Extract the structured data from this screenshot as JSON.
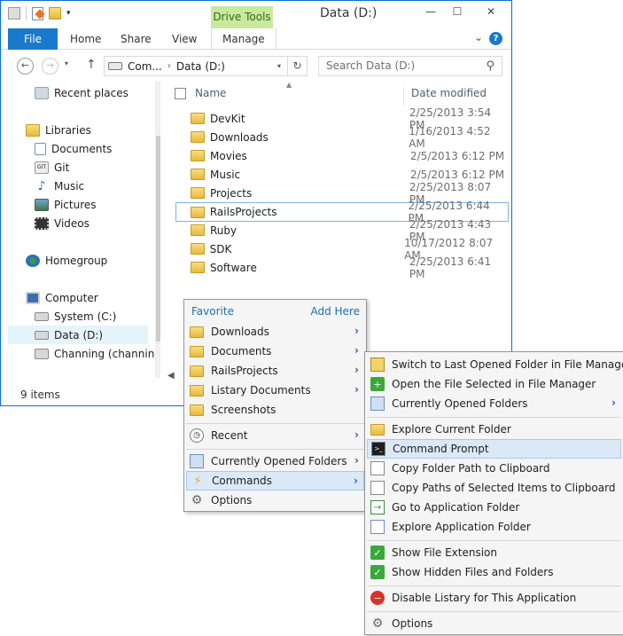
{
  "window": {
    "title": "Data (D:)",
    "context_tab_group": "Drive Tools",
    "tabs": {
      "file": "File",
      "home": "Home",
      "share": "Share",
      "view": "View",
      "manage": "Manage"
    },
    "address": {
      "part1": "Com...",
      "part2": "Data (D:)"
    },
    "search_placeholder": "Search Data (D:)",
    "status": "9 items"
  },
  "nav": {
    "items": [
      {
        "label": "Recent places",
        "icon": "recent-places-icon"
      },
      {
        "label": "Libraries",
        "icon": "libraries-icon"
      },
      {
        "label": "Documents",
        "icon": "documents-icon"
      },
      {
        "label": "Git",
        "icon": "git-icon"
      },
      {
        "label": "Music",
        "icon": "music-icon"
      },
      {
        "label": "Pictures",
        "icon": "pictures-icon"
      },
      {
        "label": "Videos",
        "icon": "videos-icon"
      },
      {
        "label": "Homegroup",
        "icon": "homegroup-icon"
      },
      {
        "label": "Computer",
        "icon": "computer-icon"
      },
      {
        "label": "System (C:)",
        "icon": "drive-icon"
      },
      {
        "label": "Data (D:)",
        "icon": "drive-icon"
      },
      {
        "label": "Channing (channing",
        "icon": "network-drive-icon"
      }
    ]
  },
  "list": {
    "headers": {
      "name": "Name",
      "date": "Date modified"
    },
    "rows": [
      {
        "name": "DevKit",
        "date": "2/25/2013 3:54 PM"
      },
      {
        "name": "Downloads",
        "date": "1/16/2013 4:52 AM"
      },
      {
        "name": "Movies",
        "date": "2/5/2013 6:12 PM"
      },
      {
        "name": "Music",
        "date": "2/5/2013 6:12 PM"
      },
      {
        "name": "Projects",
        "date": "2/25/2013 8:07 PM"
      },
      {
        "name": "RailsProjects",
        "date": "2/25/2013 6:44 PM"
      },
      {
        "name": "Ruby",
        "date": "2/25/2013 4:43 PM"
      },
      {
        "name": "SDK",
        "date": "10/17/2012 8:07 AM"
      },
      {
        "name": "Software",
        "date": "2/25/2013 6:41 PM"
      }
    ]
  },
  "menu1": {
    "favorite": "Favorite",
    "add_here": "Add Here",
    "favorites": [
      "Downloads",
      "Documents",
      "RailsProjects",
      "Listary Documents",
      "Screenshots"
    ],
    "recent": "Recent",
    "currently_opened": "Currently Opened Folders",
    "commands": "Commands",
    "options": "Options"
  },
  "menu2": {
    "items": [
      "Switch to Last Opened Folder in File Manager",
      "Open the File Selected in File Manager",
      "Currently Opened Folders",
      "Explore Current Folder",
      "Command Prompt",
      "Copy Folder Path to Clipboard",
      "Copy Paths of Selected Items to Clipboard",
      "Go to Application Folder",
      "Explore Application Folder",
      "Show File Extension",
      "Show Hidden Files and Folders",
      "Disable Listary for This Application",
      "Options"
    ]
  }
}
